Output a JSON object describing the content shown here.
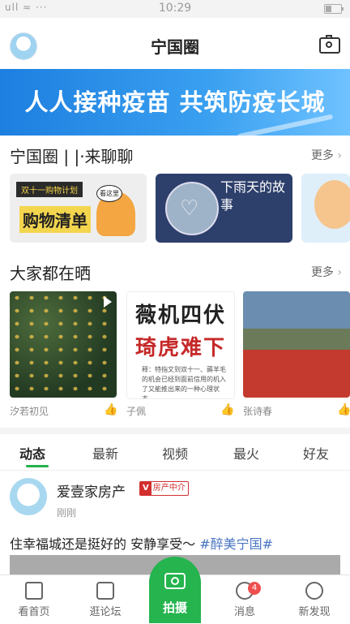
{
  "status": {
    "time": "10:29",
    "left": "ull ≈ ···"
  },
  "header": {
    "title": "宁国圈"
  },
  "banner": {
    "text": "人人接种疫苗 共筑防疫长城"
  },
  "section1": {
    "title": "宁国圈 | |·来聊聊",
    "more": "更多"
  },
  "cards": [
    {
      "tag": "双十一购物计划",
      "title": "购物清单",
      "bubble": "看这里"
    },
    {
      "title": "下雨天的故事"
    },
    {
      "title": ""
    }
  ],
  "section2": {
    "title": "大家都在晒",
    "more": "更多"
  },
  "photos": [
    {
      "author": "汐若初见"
    },
    {
      "author": "子佩",
      "line1": "薇机四伏",
      "line2": "琦虎难下",
      "caption": "释：特指文到双十一、薅羊毛的机会已经到面前信用的机入了又能推出来的一种心理状态。"
    },
    {
      "author": "张诗春"
    }
  ],
  "tabs": [
    "动态",
    "最新",
    "视频",
    "最火",
    "好友"
  ],
  "post": {
    "author": "爱壹家房产",
    "badge_v": "V",
    "badge_text": "房产中介",
    "time": "刚刚",
    "text": "住幸福城还是挺好的 安静享受～ ",
    "hashtag": "#醉美宁国#"
  },
  "nav": {
    "home": "看首页",
    "forum": "逛论坛",
    "shoot": "拍摄",
    "message": "消息",
    "message_badge": "4",
    "discover": "新发现"
  },
  "colors": {
    "accent": "#22b14c",
    "banner": "#1d7fe0",
    "hashtag": "#4a76c1",
    "badge": "#d32f2f"
  }
}
